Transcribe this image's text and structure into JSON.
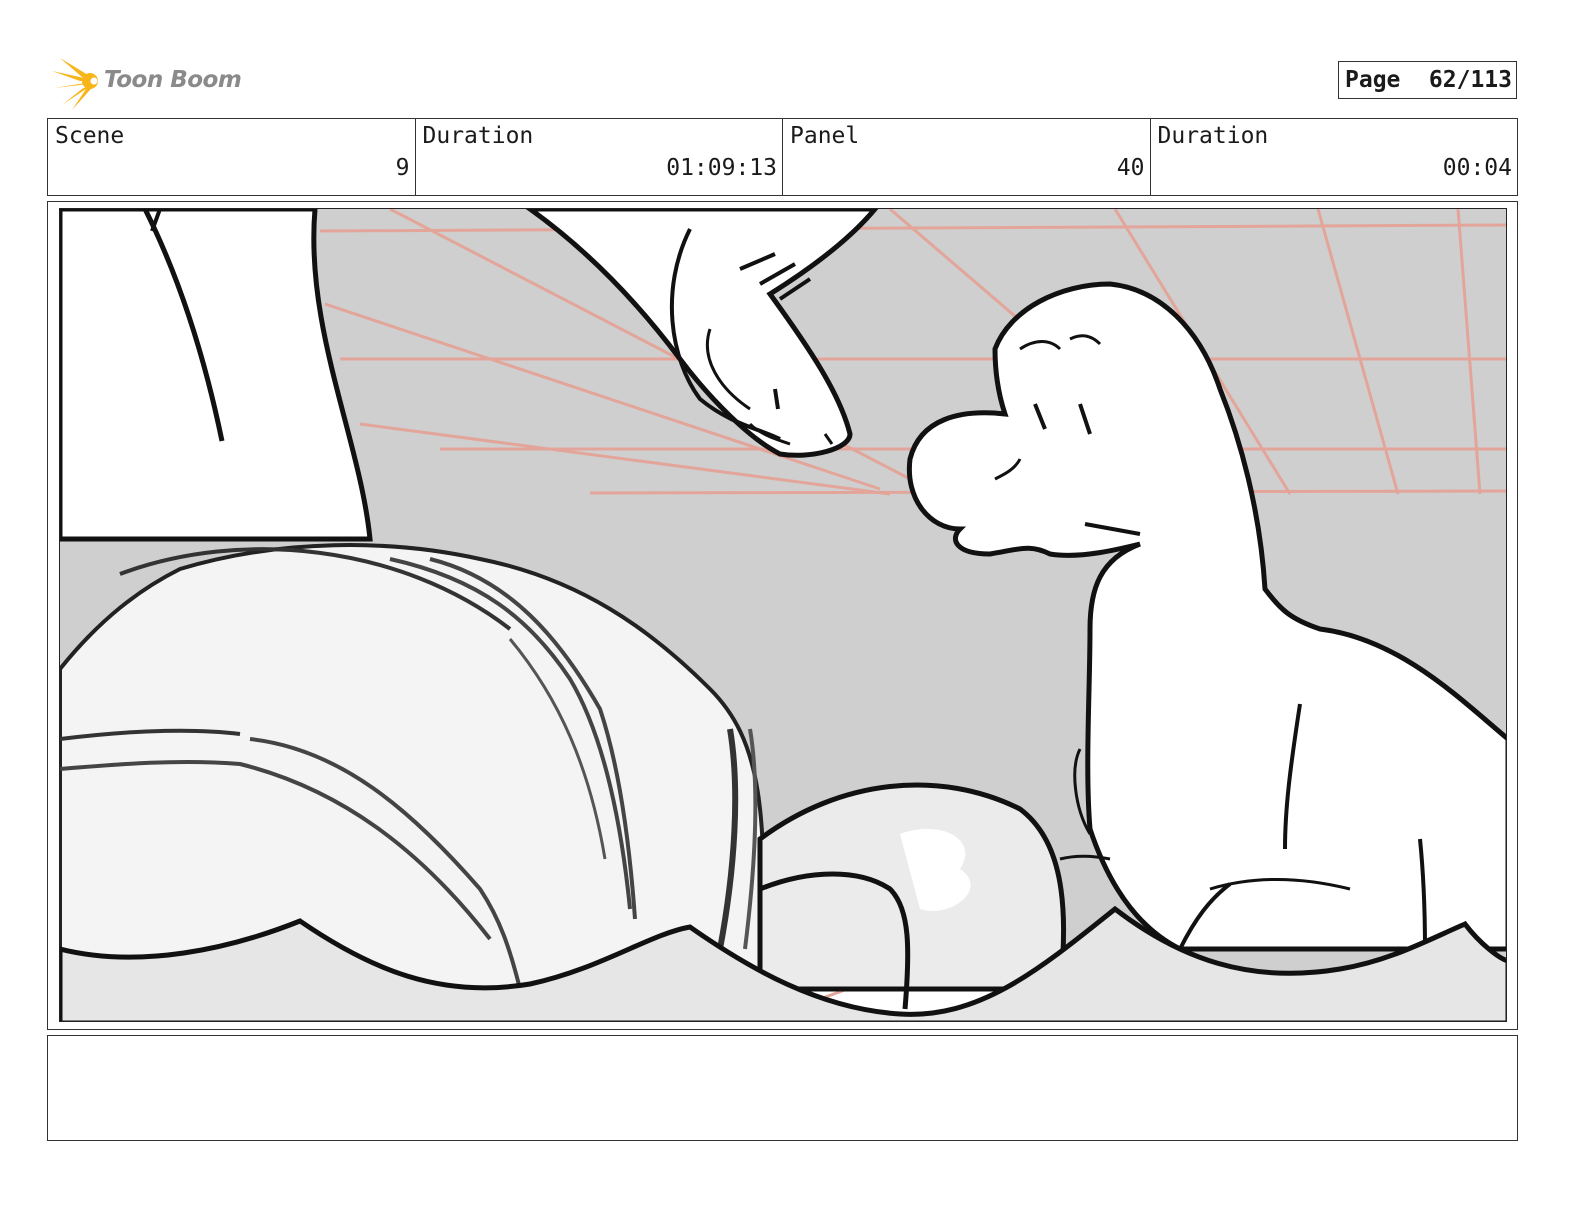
{
  "header": {
    "logo_text": "Toon Boom",
    "page_label": "Page",
    "page_value": "62/113"
  },
  "info": {
    "scene_label": "Scene",
    "scene_value": "9",
    "scene_duration_label": "Duration",
    "scene_duration_value": "01:09:13",
    "panel_label": "Panel",
    "panel_value": "40",
    "panel_duration_label": "Duration",
    "panel_duration_value": "00:04"
  },
  "notes": {
    "text": ""
  },
  "colors": {
    "logo_accent": "#f7b51a",
    "sketch_gray": "#cfcfcf",
    "guide_red": "#e3a59a"
  }
}
